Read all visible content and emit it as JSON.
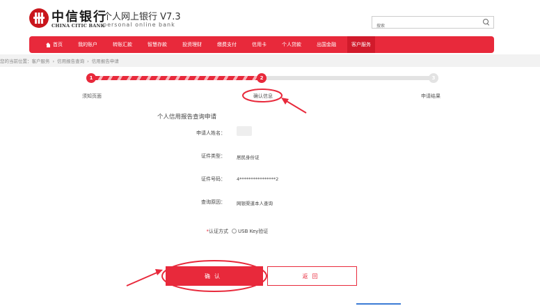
{
  "header": {
    "bank_name_cn": "中信银行",
    "bank_name_en": "CHINA CITIC BANK",
    "product_title": "个人网上银行 V7.3",
    "product_subtitle": "personal online bank",
    "search_placeholder": "搜索"
  },
  "nav": {
    "items": [
      {
        "label": "首页",
        "icon": "home-icon"
      },
      {
        "label": "我的账户"
      },
      {
        "label": "转账汇款"
      },
      {
        "label": "智慧存款"
      },
      {
        "label": "投资理财"
      },
      {
        "label": "缴费支付"
      },
      {
        "label": "信用卡"
      },
      {
        "label": "个人贷款"
      },
      {
        "label": "出国金融"
      },
      {
        "label": "客户服务",
        "active": true
      }
    ]
  },
  "breadcrumb": {
    "prefix": "您的当前位置：",
    "items": [
      "客户服务",
      "信用报告查询",
      "信用报告申请"
    ]
  },
  "steps": [
    {
      "number": "1",
      "label": "须知页面",
      "state": "done"
    },
    {
      "number": "2",
      "label": "确认信息",
      "state": "current"
    },
    {
      "number": "3",
      "label": "申请结果",
      "state": "pending"
    }
  ],
  "form": {
    "title": "个人信用报告查询申请",
    "applicant_name_label": "申请人姓名：",
    "id_type_label": "证件类型：",
    "id_type_value": "居民身份证",
    "id_number_label": "证件号码：",
    "id_number_value": "4****************2",
    "query_reason_label": "查询原因：",
    "query_reason_value": "网银渠道本人查询",
    "auth_required_mark": "*",
    "auth_label": "认证方式",
    "auth_option": "USB Key验证"
  },
  "buttons": {
    "confirm": "确认",
    "back": "返回"
  },
  "colors": {
    "brand_red": "#e8293b",
    "annotation_red": "#e8293b"
  }
}
